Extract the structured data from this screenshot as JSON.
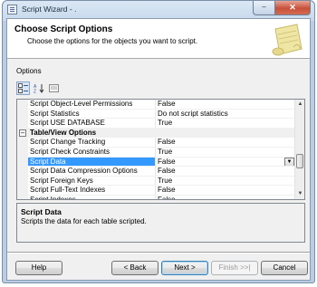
{
  "window": {
    "title": "Script Wizard - .",
    "minimize_glyph": "–",
    "maximize_glyph": "□",
    "close_glyph": "✕"
  },
  "header": {
    "title": "Choose Script Options",
    "subtitle": "Choose the options for the objects you want to script."
  },
  "options_label": "Options",
  "toolbar": {
    "buttons": [
      {
        "icon": "categorized-icon",
        "active": true
      },
      {
        "icon": "alphabetical-sort-icon",
        "active": false
      },
      {
        "icon": "property-pages-icon",
        "active": false
      }
    ]
  },
  "grid": {
    "rows": [
      {
        "type": "property",
        "name": "Script Object-Level Permissions",
        "value": "False"
      },
      {
        "type": "property",
        "name": "Script Statistics",
        "value": "Do not script statistics"
      },
      {
        "type": "property",
        "name": "Script USE DATABASE",
        "value": "True"
      },
      {
        "type": "category",
        "name": "Table/View Options",
        "expander": "–"
      },
      {
        "type": "property",
        "name": "Script Change Tracking",
        "value": "False"
      },
      {
        "type": "property",
        "name": "Script Check Constraints",
        "value": "True"
      },
      {
        "type": "property",
        "name": "Script Data",
        "value": "False",
        "selected": true
      },
      {
        "type": "property",
        "name": "Script Data Compression Options",
        "value": "False"
      },
      {
        "type": "property",
        "name": "Script Foreign Keys",
        "value": "True"
      },
      {
        "type": "property",
        "name": "Script Full-Text Indexes",
        "value": "False"
      },
      {
        "type": "property",
        "name": "Script Indexes",
        "value": "False"
      }
    ],
    "scroll_position": 0.68
  },
  "description": {
    "title": "Script Data",
    "text": "Scripts the data for each table scripted."
  },
  "buttons": {
    "help": "Help",
    "back": "< Back",
    "next": "Next >",
    "finish": "Finish >>|",
    "cancel": "Cancel"
  }
}
